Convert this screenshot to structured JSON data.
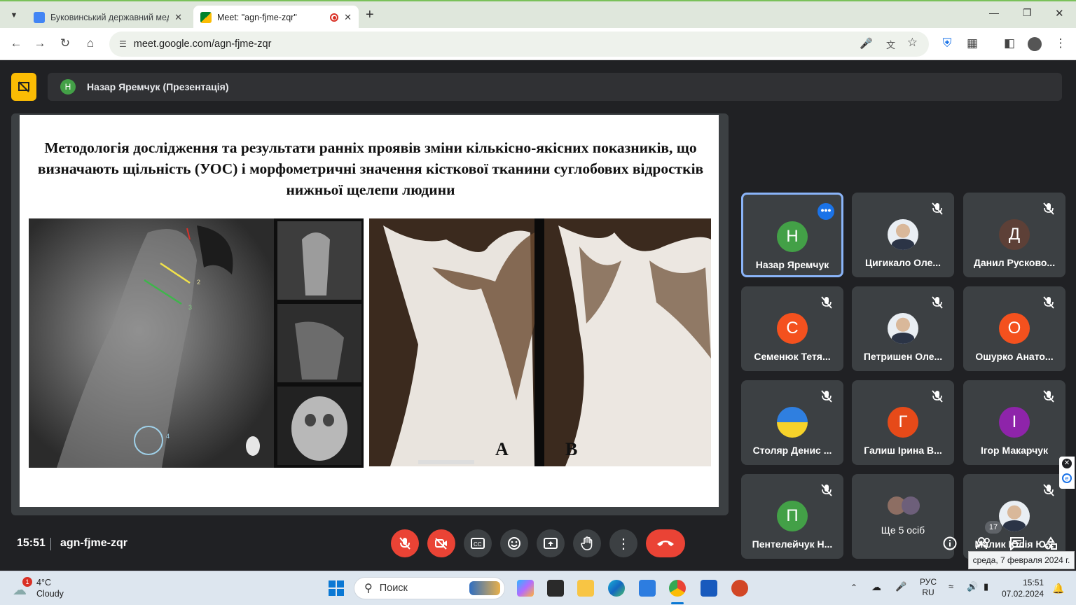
{
  "browser": {
    "tabs": [
      {
        "title": "Буковинський державний мед",
        "close": "✕"
      },
      {
        "title": "Meet: \"agn-fjme-zqr\"",
        "close": "✕"
      }
    ],
    "new_tab": "+",
    "url": "meet.google.com/agn-fjme-zqr",
    "window_controls": {
      "minimize": "—",
      "restore": "❐",
      "close": "✕"
    }
  },
  "meet": {
    "presenter_initial": "Н",
    "presenting_label": "Назар Яремчук (Презентація)",
    "slide": {
      "title": "Методологія дослідження та результати ранніх проявів зміни  кількісно-якісних показників, що визначають щільність (УОС) і морфометричні значення кісткової тканини суглобових відростків нижньої щелепи людини",
      "label_a": "A",
      "label_b": "B",
      "ct_labels": [
        "1",
        "2",
        "3",
        "4"
      ]
    },
    "participants": [
      {
        "name": "Назар Яремчук",
        "initial": "Н",
        "color": "#43a047",
        "active": true,
        "muted": false,
        "more": "•••"
      },
      {
        "name": "Цигикало Оле...",
        "initial": "",
        "photo": true,
        "muted": true
      },
      {
        "name": "Данил Русково...",
        "initial": "Д",
        "color": "#5d4037",
        "muted": true
      },
      {
        "name": "Семенюк Тетя...",
        "initial": "С",
        "color": "#f4511e",
        "muted": true
      },
      {
        "name": "Петришен Оле...",
        "initial": "",
        "photo": true,
        "muted": true
      },
      {
        "name": "Ошурко Анато...",
        "initial": "О",
        "color": "#f4511e",
        "muted": true
      },
      {
        "name": "Столяр Денис ...",
        "initial": "",
        "flag": true,
        "muted": true
      },
      {
        "name": "Галиш Ірина В...",
        "initial": "Г",
        "color": "#e64a19",
        "muted": true
      },
      {
        "name": "Ігор Макарчук",
        "initial": "І",
        "color": "#8e24aa",
        "muted": true
      },
      {
        "name": "Пентелейчук Н...",
        "initial": "П",
        "color": "#43a047",
        "muted": true
      },
      {
        "name": "Ще 5 осіб",
        "initial": "",
        "group": true,
        "muted": false
      },
      {
        "name": "Малик Юлія Ю...",
        "initial": "",
        "photo": true,
        "muted": true
      }
    ],
    "time": "15:51",
    "meeting_code": "agn-fjme-zqr",
    "people_count": "17",
    "tooltip": "среда, 7 февраля 2024 г."
  },
  "taskbar": {
    "weather_temp": "4°C",
    "weather_desc": "Cloudy",
    "weather_badge": "1",
    "search_placeholder": "Поиск",
    "lang_top": "РУС",
    "lang_bottom": "RU",
    "time": "15:51",
    "date": "07.02.2024"
  },
  "colors": {
    "accent": "#8ab4f8",
    "danger": "#ea4335",
    "present": "#fbbc04"
  }
}
